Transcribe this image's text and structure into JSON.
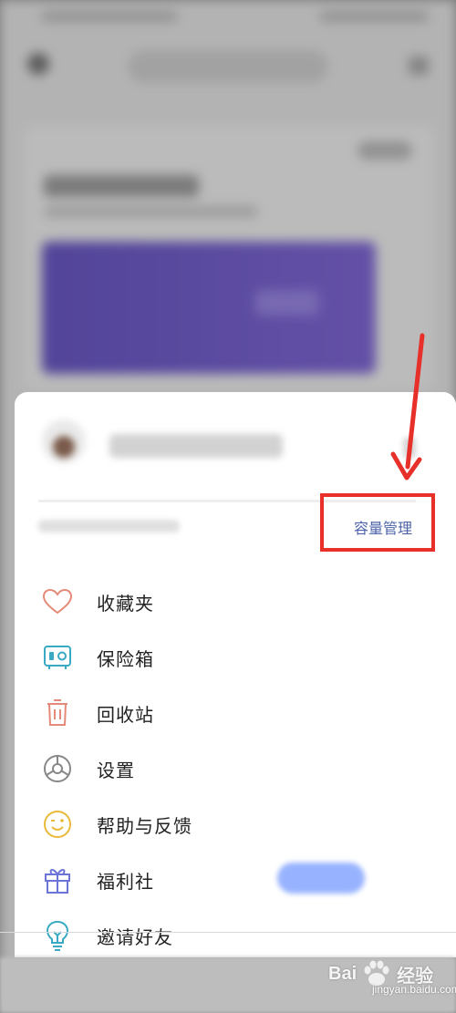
{
  "drawer": {
    "capacity_link": "容量管理"
  },
  "menu": {
    "items": [
      {
        "label": "收藏夹",
        "icon": "heart-icon"
      },
      {
        "label": "保险箱",
        "icon": "safe-icon"
      },
      {
        "label": "回收站",
        "icon": "trash-icon"
      },
      {
        "label": "设置",
        "icon": "gear-icon"
      },
      {
        "label": "帮助与反馈",
        "icon": "smiley-icon"
      },
      {
        "label": "福利社",
        "icon": "gift-icon"
      },
      {
        "label": "邀请好友",
        "icon": "lightbulb-icon"
      }
    ]
  },
  "watermark": {
    "brand": "Bai",
    "brand_suffix": "经验",
    "url": "jingyan.baidu.com"
  },
  "colors": {
    "annotation_red": "#e8302a",
    "link_blue": "#4d63a8"
  }
}
